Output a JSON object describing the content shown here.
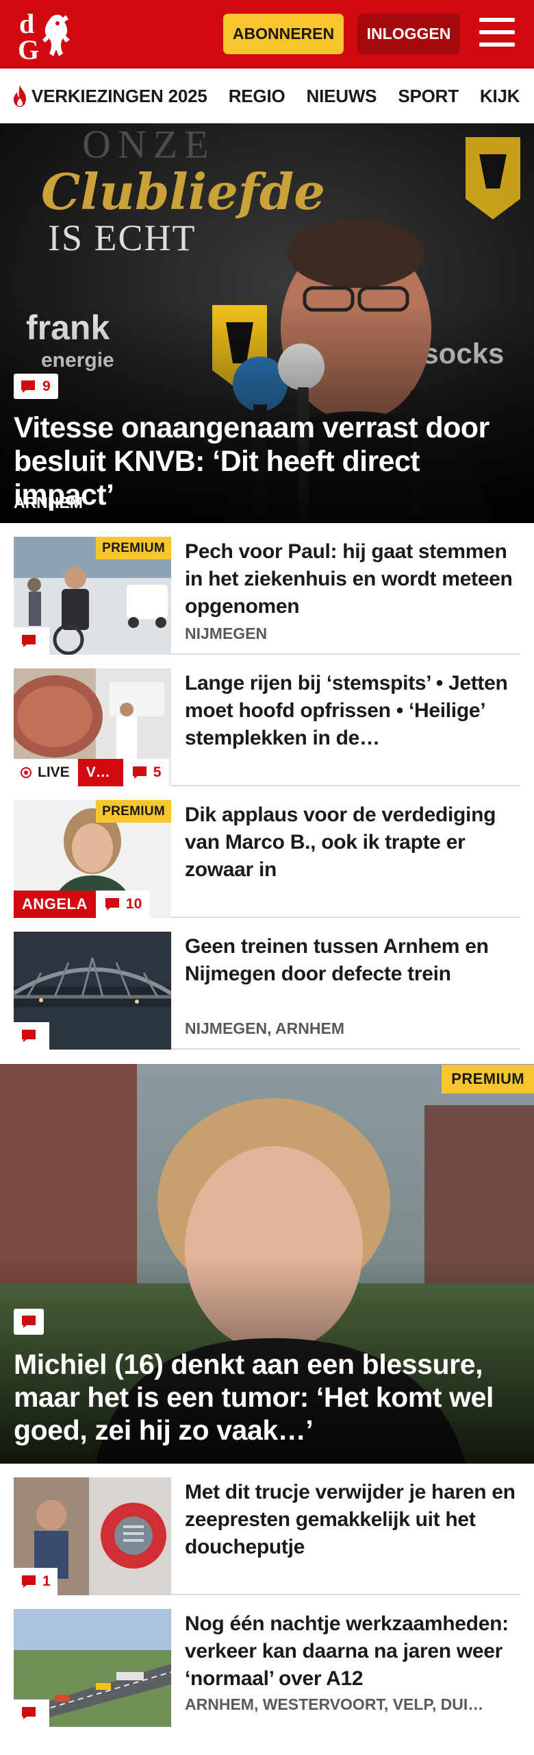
{
  "header": {
    "logo_letters": "dG",
    "subscribe_label": "ABONNEREN",
    "login_label": "INLOGGEN",
    "menu_icon": "hamburger-menu-icon",
    "colors": {
      "brand_red": "#d10a11",
      "login_bg": "#a6080d",
      "subscribe_bg": "#f7c52c"
    }
  },
  "nav": {
    "items": [
      {
        "label": "VERKIEZINGEN 2025",
        "icon": "flame-icon"
      },
      {
        "label": "REGIO"
      },
      {
        "label": "NIEUWS"
      },
      {
        "label": "SPORT"
      },
      {
        "label": "KIJK"
      }
    ]
  },
  "hero": {
    "comments": "9",
    "title": "Vitesse onaangenaam verrast door besluit KNVB: ‘Dit heeft direct impact’",
    "region": "ARNHEM",
    "image_text": {
      "line1": "ONZE",
      "line2": "Clubliefde",
      "line3": "IS ECHT",
      "sponsor": "frank",
      "sponsor_sub": "energie",
      "sponsor2": "olsocks"
    }
  },
  "articles": [
    {
      "title": "Pech voor Paul: hij gaat stemmen in het ziekenhuis en wordt meteen opgenomen",
      "region": "NIJMEGEN",
      "premium": "PREMIUM",
      "comments": ""
    },
    {
      "title": "Lange rijen bij ‘stemspits’ • Jetten moet hoofd opfrissen • ‘Heilige’ stemplekken in de…",
      "live": "LIVE",
      "live_category": "V…",
      "comments": "5"
    },
    {
      "title": "Dik applaus voor de verdediging van Marco B., ook ik trapte er zowaar in",
      "premium": "PREMIUM",
      "author": "ANGELA",
      "comments": "10"
    },
    {
      "title": "Geen treinen tussen Arnhem en Nijmegen door defecte trein",
      "region": "NIJMEGEN, ARNHEM",
      "comments": ""
    }
  ],
  "featured": {
    "premium": "PREMIUM",
    "title": "Michiel (16) denkt aan een blessure, maar het is een tumor: ‘Het komt wel goed, zei hij zo vaak…’"
  },
  "articles2": [
    {
      "title": "Met dit trucje verwijder je haren en zeeprESTEN",
      "title_full": "Met dit trucje verwijder je haren en zeepresten gemakkelijk uit het doucheputje",
      "comments": "1"
    },
    {
      "title": "Nog één nachtje werkzaamhe­den: verkeer kan daarna na jaren weer ‘normaal’ over A12",
      "region": "ARNHEM, WESTERVOORT, VELP, DUI…",
      "comments": ""
    }
  ]
}
